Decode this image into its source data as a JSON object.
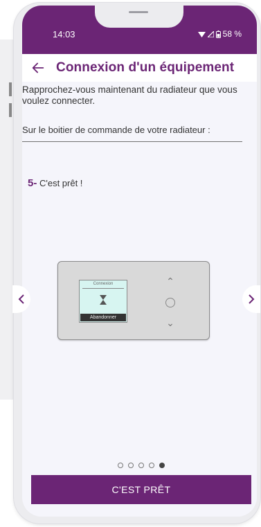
{
  "status": {
    "time": "14:03",
    "battery": "58 %"
  },
  "header": {
    "title": "Connexion d'un équipement",
    "back_icon": "arrow-left-icon"
  },
  "instructions": {
    "primary": "Rapprochez-vous maintenant du radiateur que vous voulez connecter.",
    "secondary": "Sur le boitier de commande de votre radiateur :"
  },
  "step": {
    "number": "5-",
    "text": "C'est prêt !"
  },
  "device": {
    "screen_title": "Connexion",
    "screen_button": "Abandonner"
  },
  "carousel": {
    "prev_icon": "chevron-left-icon",
    "next_icon": "chevron-right-icon",
    "total": 5,
    "active": 5
  },
  "cta": {
    "label": "C'EST PRÊT"
  },
  "colors": {
    "primary": "#6b2575",
    "screen_bg": "#f5f5fb",
    "lcd": "#d7f5f1"
  }
}
